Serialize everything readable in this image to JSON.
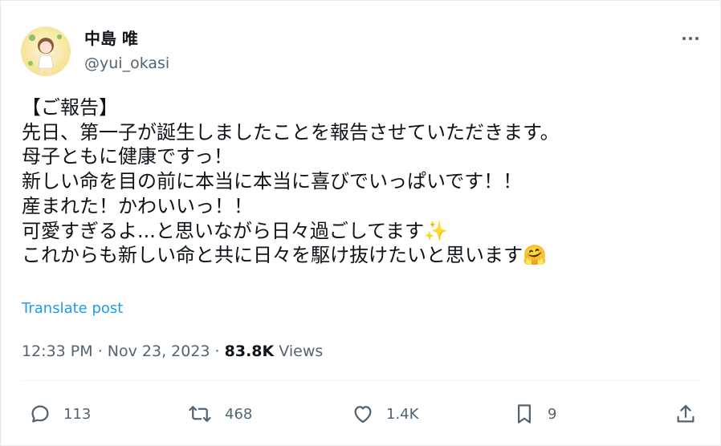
{
  "author": {
    "display_name": "中島 唯",
    "handle": "@yui_okasi"
  },
  "post": {
    "lines": [
      "【ご報告】",
      "先日、第一子が誕生しましたことを報告させていただきます。",
      "母子ともに健康ですっ！",
      "新しい命を目の前に本当に本当に喜びでいっぱいです！！",
      "産まれた！かわいいっ！！",
      "可愛すぎるよ...と思いながら日々過ごしてます✨",
      "これからも新しい命と共に日々を駆け抜けたいと思います🤗"
    ],
    "translate_label": "Translate post"
  },
  "meta": {
    "time": "12:33 PM",
    "separator": " · ",
    "date": "Nov 23, 2023",
    "views_count": "83.8K",
    "views_label": " Views"
  },
  "actions": {
    "replies": "113",
    "reposts": "468",
    "likes": "1.4K",
    "bookmarks": "9"
  },
  "icons": [
    "more-icon",
    "reply-icon",
    "repost-icon",
    "like-icon",
    "bookmark-icon",
    "share-icon"
  ],
  "colors": {
    "link": "#1d9bf0",
    "secondary_text": "#536471",
    "primary_text": "#0f1419"
  }
}
